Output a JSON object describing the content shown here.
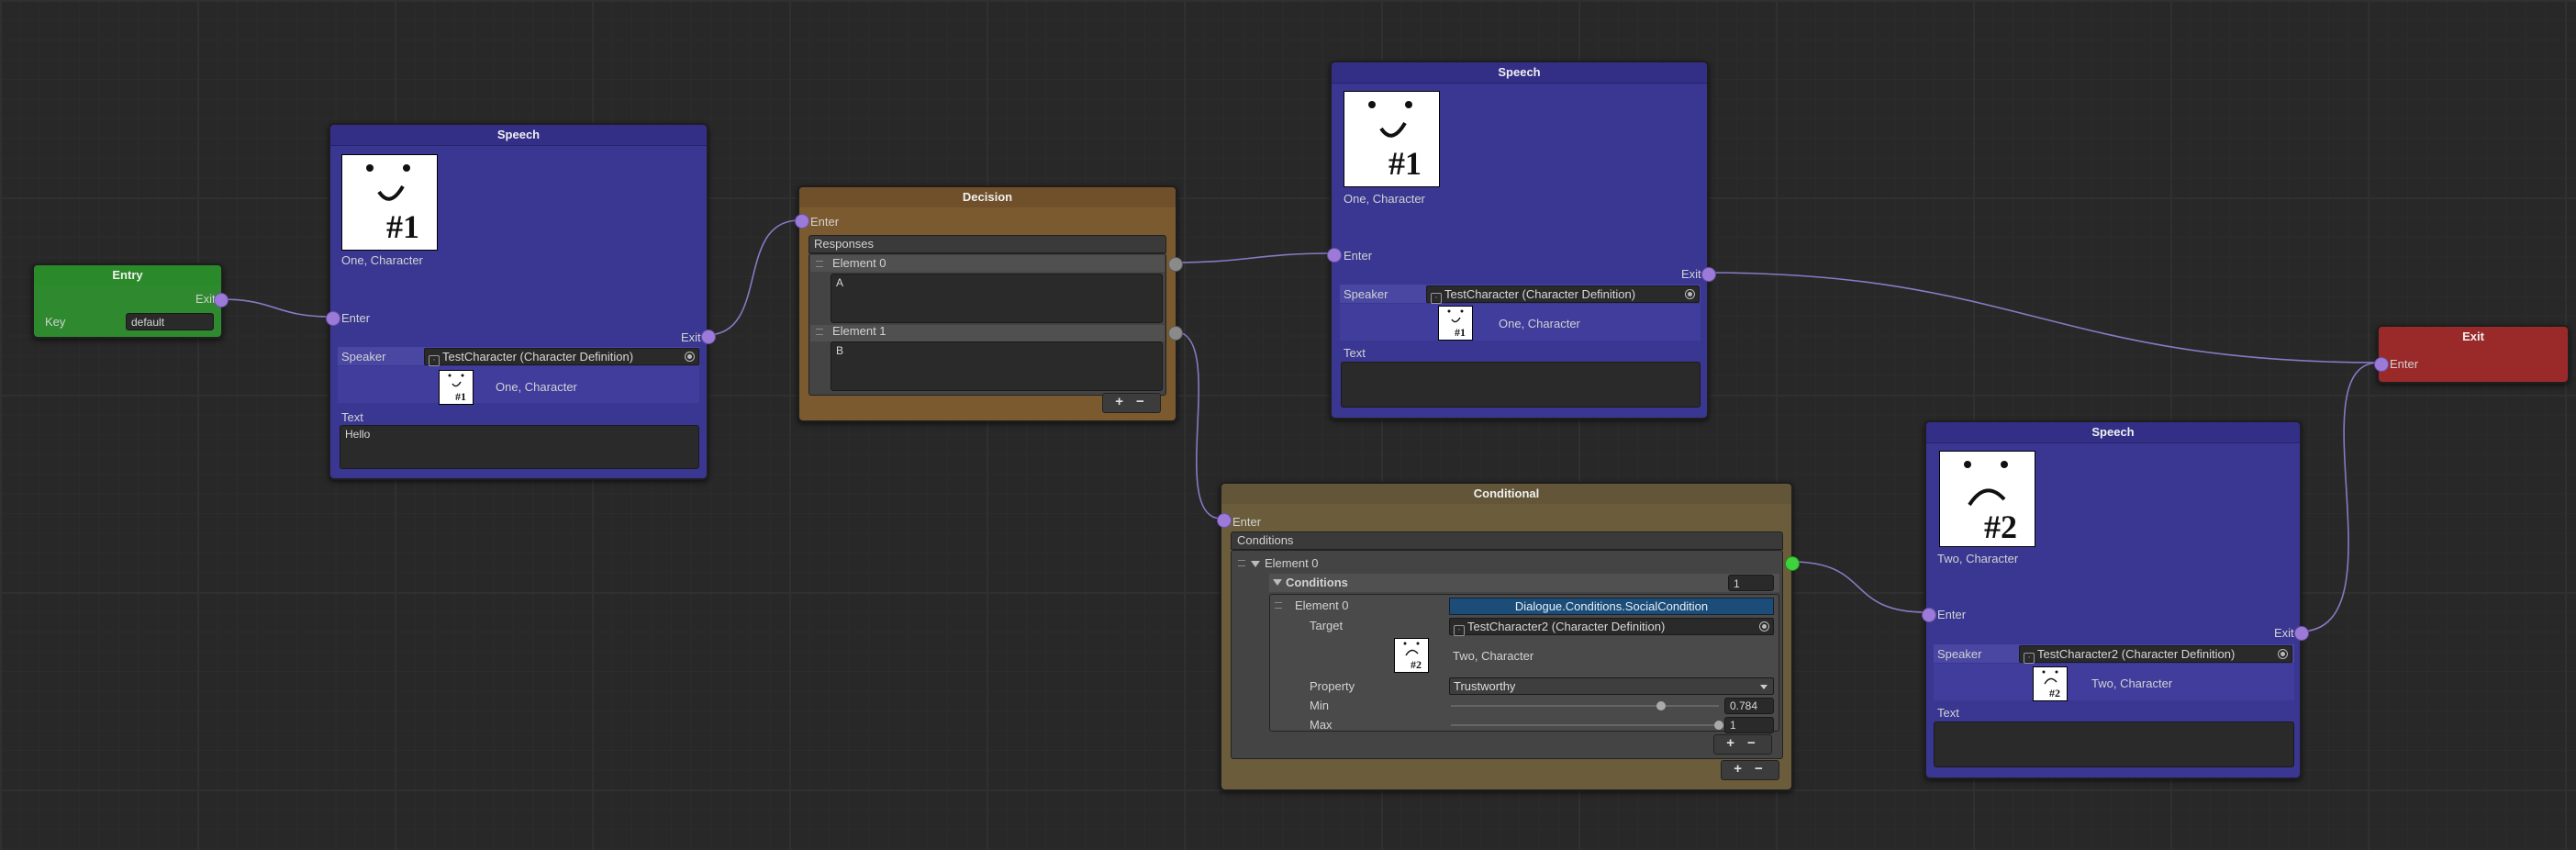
{
  "colors": {
    "speech": "#3a3792",
    "decision": "#7c5a2f",
    "conditional": "#6b5d3c",
    "entry": "#2f8a2f",
    "exit": "#9a2a2a",
    "port": "#9b7ad8",
    "port_active": "#3fd23f"
  },
  "entry": {
    "title": "Entry",
    "exit_label": "Exit",
    "key_label": "Key",
    "key_value": "default"
  },
  "speech1": {
    "title": "Speech",
    "portrait_name": "One, Character",
    "enter_label": "Enter",
    "exit_label": "Exit",
    "speaker_label": "Speaker",
    "speaker_value": "TestCharacter (Character Definition)",
    "speaker_name": "One, Character",
    "text_label": "Text",
    "text_value": "Hello",
    "face_tag": "#1"
  },
  "decision": {
    "title": "Decision",
    "enter_label": "Enter",
    "responses_label": "Responses",
    "elements": [
      {
        "label": "Element 0",
        "value": "A"
      },
      {
        "label": "Element 1",
        "value": "B"
      }
    ],
    "plus": "+",
    "minus": "−"
  },
  "speech2": {
    "title": "Speech",
    "portrait_name": "One, Character",
    "enter_label": "Enter",
    "exit_label": "Exit",
    "speaker_label": "Speaker",
    "speaker_value": "TestCharacter (Character Definition)",
    "speaker_name": "One, Character",
    "text_label": "Text",
    "text_value": "",
    "face_tag": "#1"
  },
  "conditional": {
    "title": "Conditional",
    "enter_label": "Enter",
    "conditions_label": "Conditions",
    "element0_label": "Element 0",
    "inner_conditions_label": "Conditions",
    "inner_conditions_count": "1",
    "inner_element0_label": "Element 0",
    "condition_type": "Dialogue.Conditions.SocialCondition",
    "target_label": "Target",
    "target_value": "TestCharacter2 (Character Definition)",
    "target_name": "Two, Character",
    "property_label": "Property",
    "property_value": "Trustworthy",
    "min_label": "Min",
    "min_value": "0.784",
    "min_fraction": 0.784,
    "max_label": "Max",
    "max_value": "1",
    "max_fraction": 1.0,
    "plus": "+",
    "minus": "−",
    "face_tag": "#2"
  },
  "speech3": {
    "title": "Speech",
    "portrait_name": "Two, Character",
    "enter_label": "Enter",
    "exit_label": "Exit",
    "speaker_label": "Speaker",
    "speaker_value": "TestCharacter2 (Character Definition)",
    "speaker_name": "Two, Character",
    "text_label": "Text",
    "text_value": "",
    "face_tag": "#2"
  },
  "exit": {
    "title": "Exit",
    "enter_label": "Enter"
  }
}
